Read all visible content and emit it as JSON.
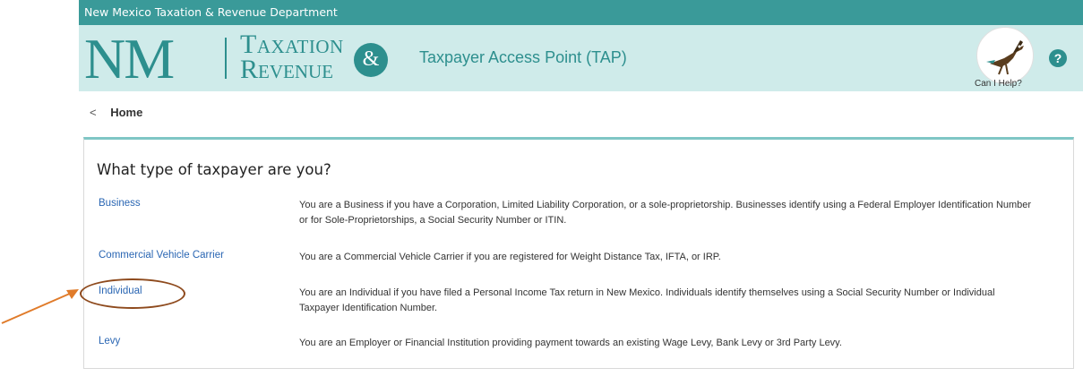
{
  "topbar": {
    "text": "New Mexico Taxation & Revenue Department"
  },
  "logo": {
    "nm": "NM",
    "line1": "Taxation",
    "line2": "Revenue",
    "amp": "&"
  },
  "header": {
    "tap_title": "Taxpayer Access Point (TAP)"
  },
  "help": {
    "label": "Can I Help?",
    "q": "?"
  },
  "breadcrumb": {
    "chevron": "<",
    "home": "Home"
  },
  "card": {
    "title": "What type of taxpayer are you?",
    "rows": [
      {
        "label": "Business",
        "description": "You are a Business if you have a Corporation, Limited Liability Corporation, or a sole-proprietorship. Businesses identify using a Federal Employer Identification Number or for Sole-Proprietorships, a Social Security Number or ITIN."
      },
      {
        "label": "Commercial Vehicle Carrier",
        "description": "You are a Commercial Vehicle Carrier if you are registered for Weight Distance Tax, IFTA, or IRP."
      },
      {
        "label": "Individual",
        "description": "You are an Individual if you have filed a Personal Income Tax return in New Mexico. Individuals identify themselves using a Social Security Number or Individual Taxpayer Identification Number."
      },
      {
        "label": "Levy",
        "description": "You are an Employer or Financial Institution providing payment towards an existing Wage Levy, Bank Levy or 3rd Party Levy."
      }
    ]
  },
  "colors": {
    "teal": "#3a9a99",
    "header_bg": "#cfebea",
    "link": "#2a66b3",
    "annotation": "#e07b2a"
  }
}
